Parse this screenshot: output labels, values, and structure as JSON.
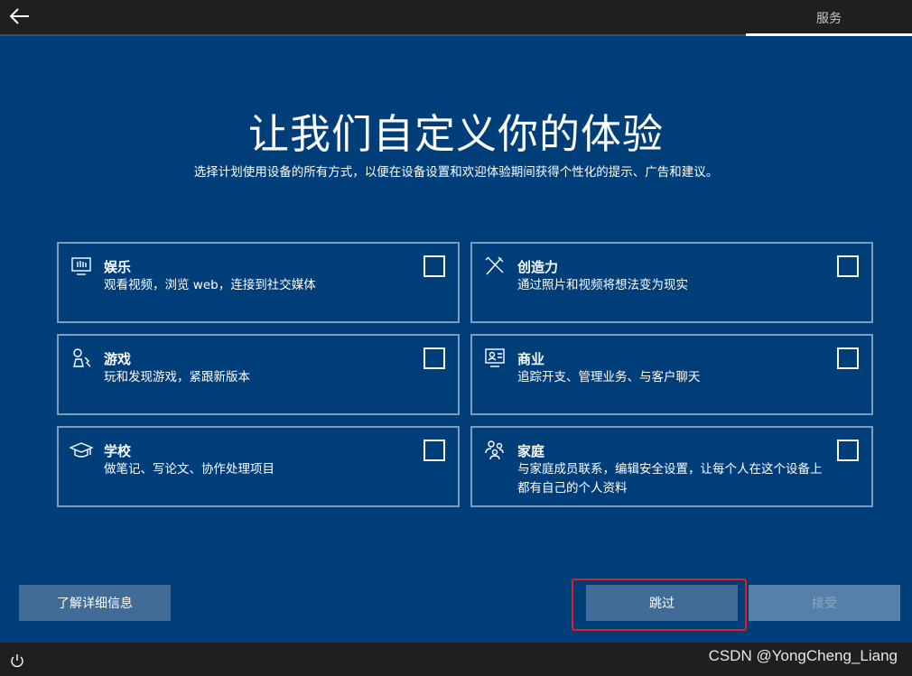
{
  "header": {
    "top_tab": "服务"
  },
  "main": {
    "title": "让我们自定义你的体验",
    "subtitle": "选择计划使用设备的所有方式，以便在设备设置和欢迎体验期间获得个性化的提示、广告和建议。"
  },
  "cards": [
    {
      "icon": "entertainment-icon",
      "title": "娱乐",
      "desc": "观看视频，浏览 web，连接到社交媒体"
    },
    {
      "icon": "creativity-icon",
      "title": "创造力",
      "desc": "通过照片和视频将想法变为现实"
    },
    {
      "icon": "gaming-icon",
      "title": "游戏",
      "desc": "玩和发现游戏，紧跟新版本"
    },
    {
      "icon": "business-icon",
      "title": "商业",
      "desc": "追踪开支、管理业务、与客户聊天"
    },
    {
      "icon": "school-icon",
      "title": "学校",
      "desc": "做笔记、写论文、协作处理项目"
    },
    {
      "icon": "family-icon",
      "title": "家庭",
      "desc": "与家庭成员联系，编辑安全设置，让每个人在这个设备上都有自己的个人资料"
    }
  ],
  "footer": {
    "learn_more": "了解详细信息",
    "skip": "跳过",
    "accept": "接受"
  },
  "watermark": "CSDN @YongCheng_Liang",
  "colors": {
    "background": "#003e7a",
    "bar": "#1f1f1f",
    "button": "#416c96",
    "highlight": "#e02020"
  }
}
